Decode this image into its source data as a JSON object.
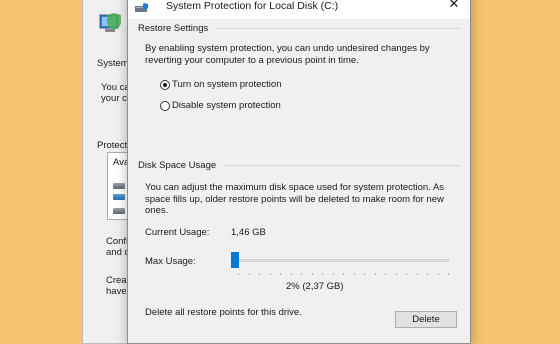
{
  "background_window": {
    "label_system": "System",
    "text_line1": "You ca",
    "text_line2": "your co",
    "label_protection": "Protectio",
    "box_header": "Ava",
    "text_config1": "Confi",
    "text_config2": "and d",
    "text_create1": "Creat",
    "text_create2": "have"
  },
  "dialog": {
    "title": "System Protection for Local Disk (C:)",
    "close_glyph": "✕",
    "restore_settings": {
      "header": "Restore Settings",
      "description_line1": "By enabling system protection, you can undo undesired changes by",
      "description_line2": "reverting your computer to a previous point in time.",
      "option_on": "Turn on system protection",
      "option_off": "Disable system protection",
      "selected": "on"
    },
    "disk_space": {
      "header": "Disk Space Usage",
      "description_line1": "You can adjust the maximum disk space used for system protection. As",
      "description_line2": "space fills up, older restore points will be deleted to make room for new",
      "description_line3": "ones.",
      "current_usage_label": "Current Usage:",
      "current_usage_value": "1,46 GB",
      "max_usage_label": "Max Usage:",
      "max_usage_value": "2% (2,37 GB)",
      "max_usage_percent": 2,
      "delete_text": "Delete all restore points for this drive.",
      "delete_button": "Delete"
    }
  },
  "colors": {
    "desktop_background": "#f5c46e",
    "slider_thumb": "#0078d7",
    "dialog_background": "#f0f0f0"
  }
}
